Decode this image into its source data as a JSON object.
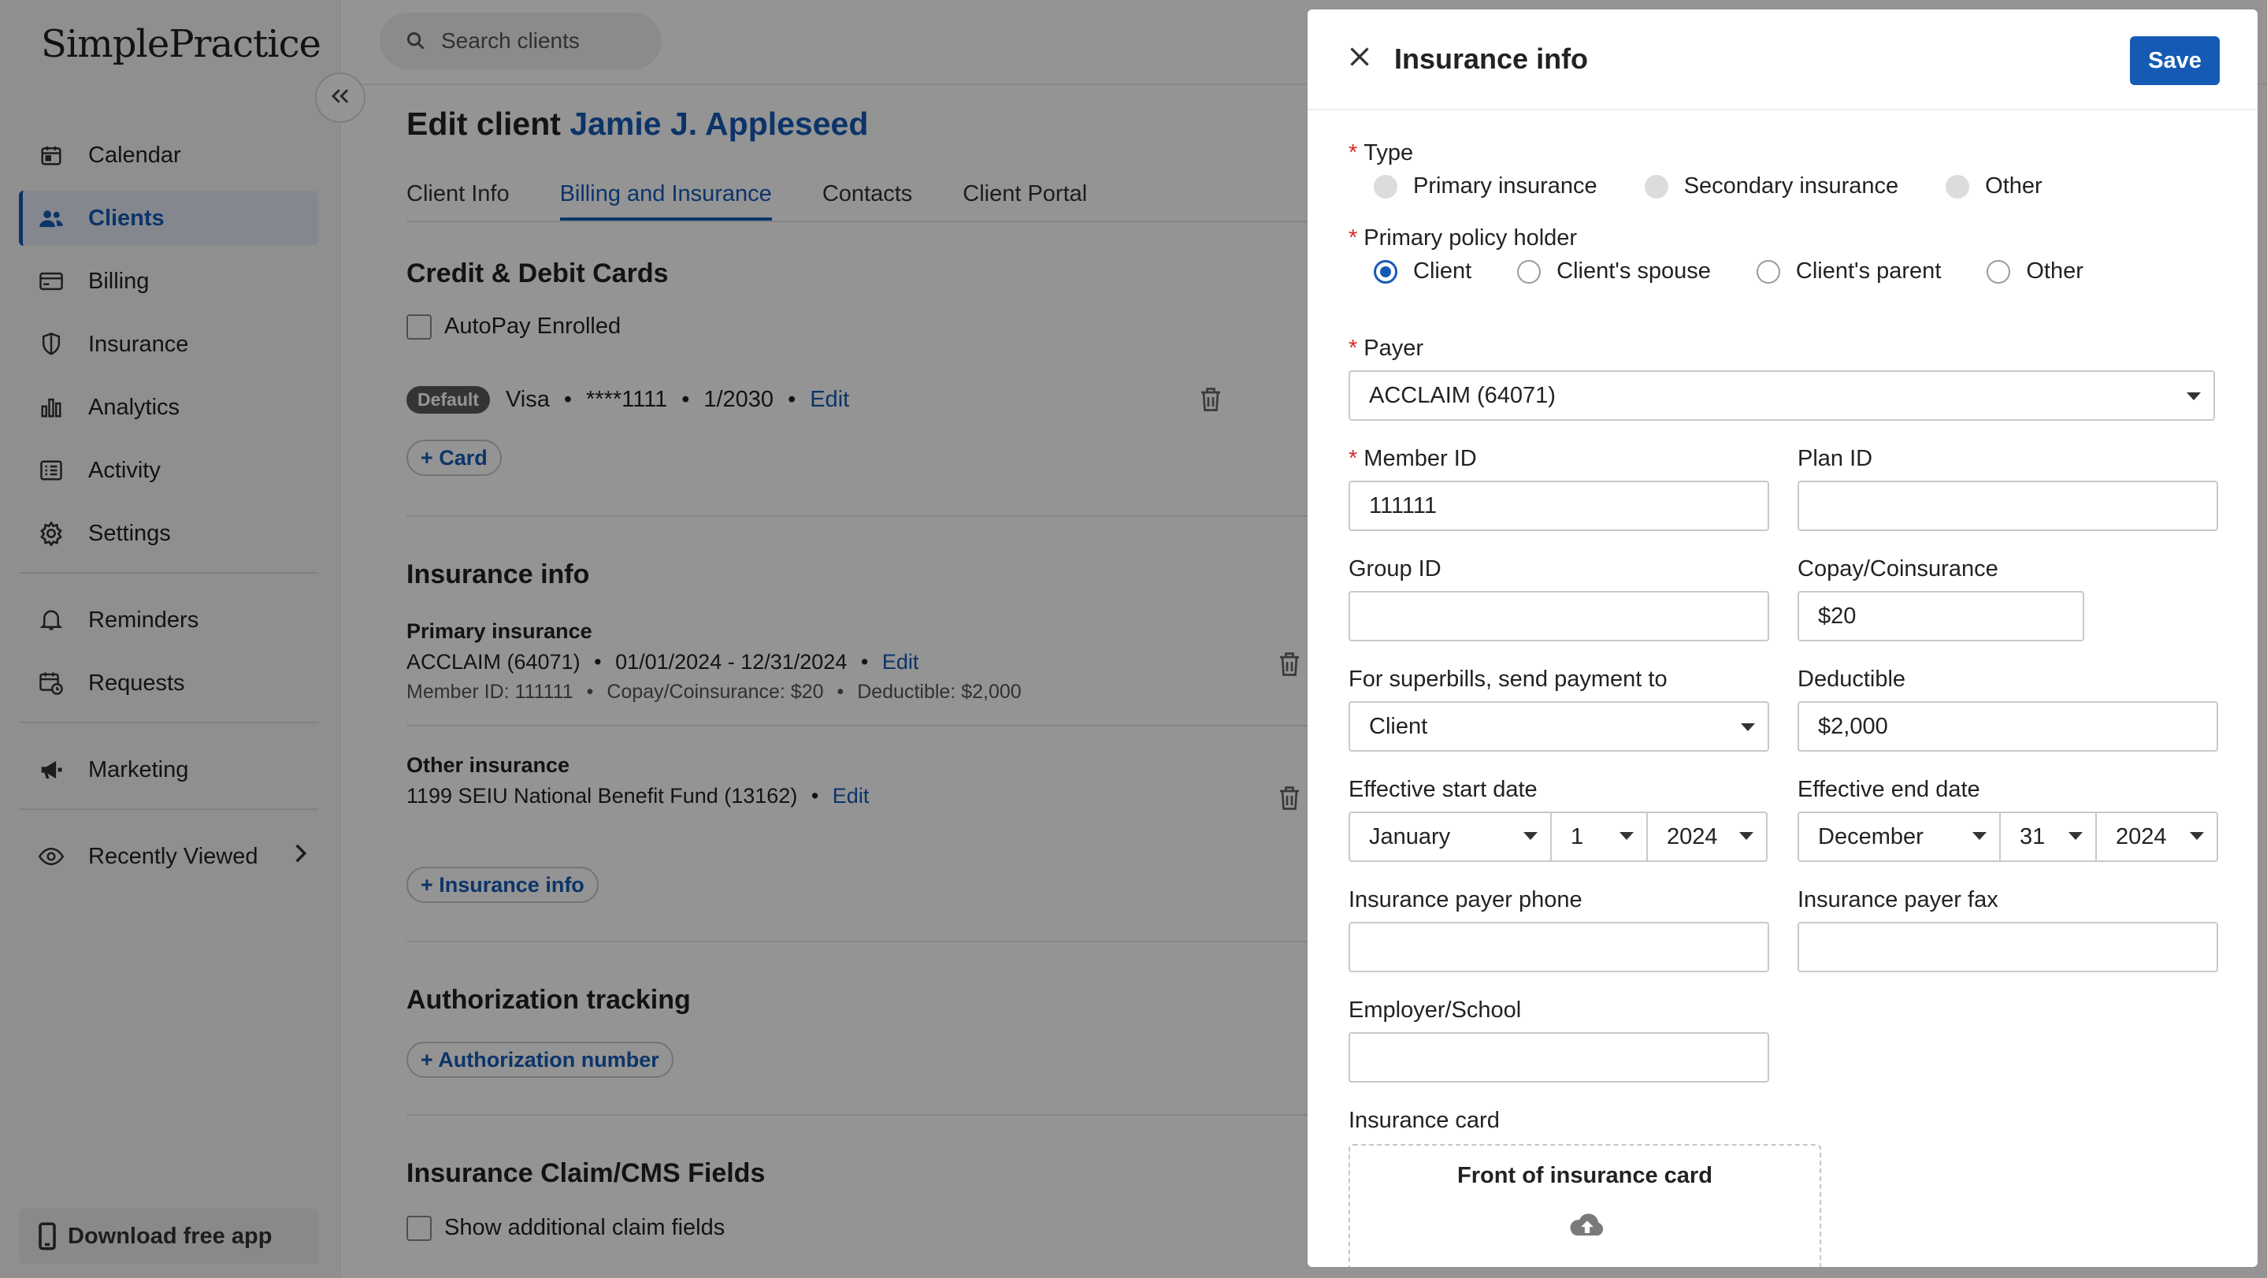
{
  "sidebar": {
    "logo": "SimplePractice",
    "collapse_icon": "double-chevron-left-icon",
    "items": [
      {
        "label": "Calendar",
        "icon": "calendar-icon"
      },
      {
        "label": "Clients",
        "icon": "users-icon"
      },
      {
        "label": "Billing",
        "icon": "credit-card-icon"
      },
      {
        "label": "Insurance",
        "icon": "shield-icon"
      },
      {
        "label": "Analytics",
        "icon": "bar-chart-icon"
      },
      {
        "label": "Activity",
        "icon": "list-icon"
      },
      {
        "label": "Settings",
        "icon": "gear-icon"
      },
      {
        "label": "Reminders",
        "icon": "bell-icon"
      },
      {
        "label": "Requests",
        "icon": "calendar-clock-icon"
      },
      {
        "label": "Marketing",
        "icon": "megaphone-icon"
      },
      {
        "label": "Recently Viewed",
        "icon": "eye-icon"
      }
    ],
    "active_item": "Clients",
    "download_label": "Download free app"
  },
  "header": {
    "search_placeholder": "Search clients"
  },
  "main": {
    "title_prefix": "Edit client",
    "client_name": "Jamie J. Appleseed",
    "tabs": [
      "Client Info",
      "Billing and Insurance",
      "Contacts",
      "Client Portal"
    ],
    "active_tab": "Billing and Insurance",
    "cards": {
      "title": "Credit & Debit Cards",
      "autopay_label": "AutoPay Enrolled",
      "default_badge": "Default",
      "card_brand": "Visa",
      "card_number": "****1111",
      "card_exp": "1/2030",
      "edit_label": "Edit",
      "add_card": "+ Card"
    },
    "insurance": {
      "title": "Insurance info",
      "primary": {
        "heading": "Primary insurance",
        "payer": "ACCLAIM (64071)",
        "dates": "01/01/2024 - 12/31/2024",
        "edit": "Edit",
        "member": "Member ID: 111111",
        "copay": "Copay/Coinsurance: $20",
        "deductible": "Deductible: $2,000"
      },
      "other": {
        "heading": "Other insurance",
        "payer": "1199 SEIU National Benefit Fund (13162)",
        "edit": "Edit"
      },
      "add_label": "+ Insurance info"
    },
    "authorization": {
      "title": "Authorization tracking",
      "add_label": "+ Authorization number"
    },
    "claim": {
      "title": "Insurance Claim/CMS Fields",
      "checkbox_label": "Show additional claim fields"
    }
  },
  "drawer": {
    "title": "Insurance info",
    "save_label": "Save",
    "type": {
      "label": "Type",
      "options": [
        "Primary insurance",
        "Secondary insurance",
        "Other"
      ]
    },
    "policy_holder": {
      "label": "Primary policy holder",
      "options": [
        "Client",
        "Client's spouse",
        "Client's parent",
        "Other"
      ],
      "selected": "Client"
    },
    "payer": {
      "label": "Payer",
      "value": "ACCLAIM (64071)"
    },
    "member_id": {
      "label": "Member ID",
      "value": "111111"
    },
    "plan_id": {
      "label": "Plan ID",
      "value": ""
    },
    "group_id": {
      "label": "Group ID",
      "value": ""
    },
    "copay": {
      "label": "Copay/Coinsurance",
      "value": "$20"
    },
    "superbills": {
      "label": "For superbills, send payment to",
      "value": "Client"
    },
    "deductible": {
      "label": "Deductible",
      "value": "$2,000"
    },
    "start_date": {
      "label": "Effective start date",
      "month": "January",
      "day": "1",
      "year": "2024"
    },
    "end_date": {
      "label": "Effective end date",
      "month": "December",
      "day": "31",
      "year": "2024"
    },
    "payer_phone": {
      "label": "Insurance payer phone",
      "value": ""
    },
    "payer_fax": {
      "label": "Insurance payer fax",
      "value": ""
    },
    "employer": {
      "label": "Employer/School",
      "value": ""
    },
    "card": {
      "label": "Insurance card",
      "front_label": "Front of insurance card",
      "upload_icon": "cloud-upload-icon"
    }
  },
  "colors": {
    "brand": "#155bb5",
    "required": "#d12c2c",
    "overlay": "rgba(0,0,0,0.42)"
  }
}
